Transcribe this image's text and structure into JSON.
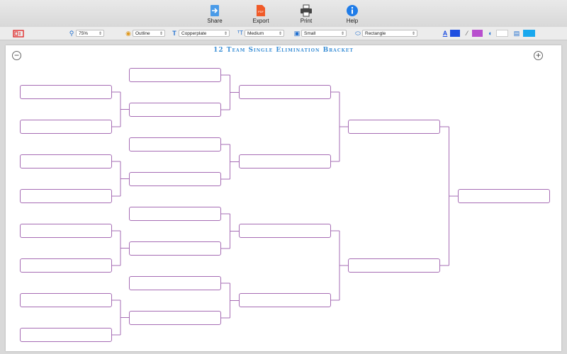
{
  "toolbar": {
    "share_label": "Share",
    "export_label": "Export",
    "print_label": "Print",
    "help_label": "Help"
  },
  "format": {
    "zoom": "75%",
    "outline": "Outline",
    "font": "Copperplate",
    "text_size": "Medium",
    "box_size": "Small",
    "shape": "Rectangle"
  },
  "colors": {
    "accent": "#3b8fd6",
    "bracket_line": "#a66cb4",
    "fill_blue": "#1f4fe0",
    "line_purple": "#b84fce",
    "bg_cyan": "#19a8ee"
  },
  "icons": {
    "share": "share-icon",
    "export": "pdf-icon",
    "print": "printer-icon",
    "help": "info-icon"
  },
  "bracket": {
    "title": "12 Team Single Elimination Bracket"
  }
}
